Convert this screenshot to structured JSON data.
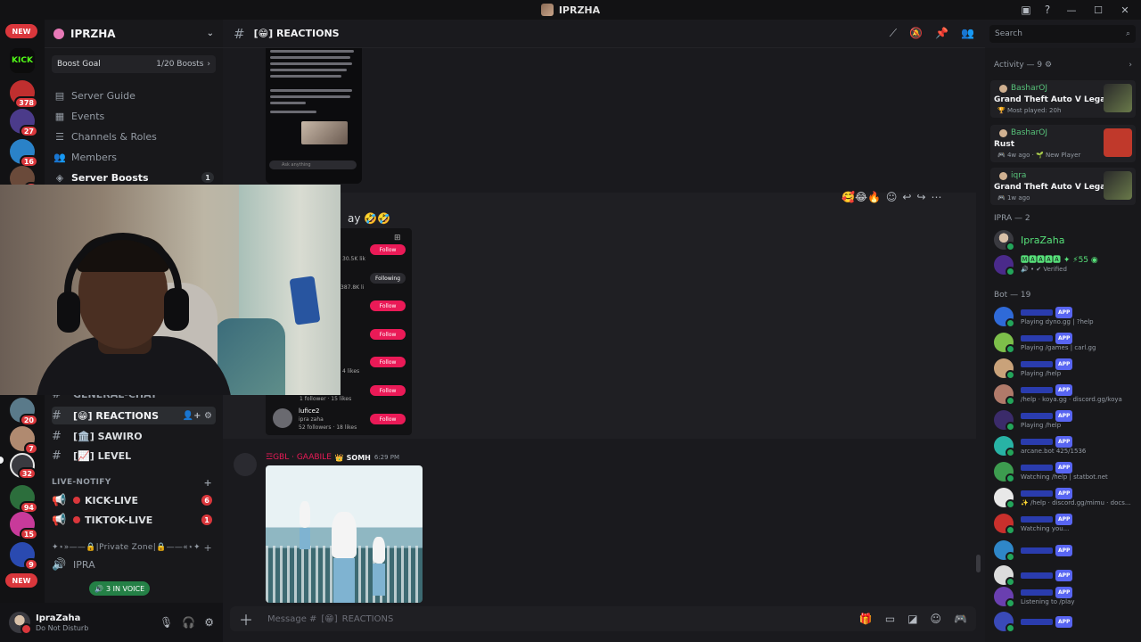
{
  "window": {
    "title": "IPRZHA"
  },
  "rail": {
    "new_label": "NEW",
    "kick_label": "KICK",
    "badges": [
      "378",
      "27",
      "16",
      "1",
      "20",
      "7",
      "32",
      "94",
      "15",
      "9"
    ]
  },
  "server": {
    "name": "IPRZHA",
    "boost_goal_label": "Boost Goal",
    "boost_progress": "1/20 Boosts",
    "nav": [
      {
        "label": "Server Guide"
      },
      {
        "label": "Events"
      },
      {
        "label": "Channels & Roles"
      },
      {
        "label": "Members"
      },
      {
        "label": "Server Boosts",
        "count": "1"
      }
    ]
  },
  "channels": {
    "partial": "GENERAL-CHAT",
    "list": [
      {
        "name": "REACTIONS",
        "prefix": "[😁]"
      },
      {
        "name": "SAWIRO",
        "prefix": "[🏛️]"
      },
      {
        "name": "LEVEL",
        "prefix": "[📈]"
      }
    ],
    "category_live": "LIVE-NOTIFY",
    "live": [
      {
        "name": "KICK-LIVE",
        "badge": "6"
      },
      {
        "name": "TIKTOK-LIVE",
        "badge": "1"
      }
    ],
    "private_zone": "✦⋆»——🔒|Private Zone|🔒——«⋆✦",
    "voice_channel": "IPRA",
    "voice_pill": "3 IN VOICE"
  },
  "user": {
    "name": "IpraZaha",
    "status": "Do Not Disturb"
  },
  "chat": {
    "channel_name": "REACTIONS",
    "channel_prefix": "[😁]",
    "search_placeholder": "Search",
    "input_placeholder": "Message #",
    "input_channel": "REACTIONS",
    "input_prefix": "[😁]",
    "emoji_suffix": "ay 🤣🤣",
    "reactions": "🥰😂🔥",
    "phone2": {
      "follow_label": "Follow",
      "following_label": "Following",
      "counts": [
        "30.5K lik",
        "387.8K li",
        "4 likes"
      ],
      "row_a": "1 follower · 15 likes",
      "user2_name": "lufice2",
      "user2_handle": "ipra zaha",
      "user2_stats": "52 followers · 18 likes"
    },
    "msg2": {
      "author": "☲GBL · GAABILE",
      "tag": "👑 SOMH",
      "time": "6:29 PM"
    }
  },
  "members": {
    "activity_header": "Activity — 9 ⚙",
    "activities": [
      {
        "user": "BasharOJ",
        "game": "Grand Theft Auto V Legacy",
        "sub": "🏆 Most played: 20h",
        "color": "#1c1c1c"
      },
      {
        "user": "BasharOJ",
        "game": "Rust",
        "sub": "🎮 4w ago · 🌱 New Player",
        "color": "#c0392b"
      },
      {
        "user": "iqra",
        "game": "Grand Theft Auto V Legacy",
        "sub": "🎮 1w ago",
        "color": "#1c1c1c"
      }
    ],
    "ipra_header": "IPRA — 2",
    "ipra": [
      {
        "name": "IpraZaha",
        "sub": ""
      },
      {
        "name": "🅼🅰🅰🅰🅰 ✦ ⚡55 ◉",
        "sub": "🔊 • ✔ Verified"
      }
    ],
    "bot_header": "Bot — 19",
    "bots": [
      {
        "status": "Playing dyno.gg | ?help",
        "color": "#2f6ad8"
      },
      {
        "status": "Playing /games | carl.gg",
        "color": "#7dbf4a"
      },
      {
        "status": "Playing /help",
        "color": "#c9a27a"
      },
      {
        "status": "/help · koya.gg · discord.gg/koya",
        "color": "#b07a6a"
      },
      {
        "status": "Playing /help",
        "color": "#3b2b6a"
      },
      {
        "status": "arcane.bot 425/1536",
        "color": "#28b3a5"
      },
      {
        "status": "Watching /help | statbot.net",
        "color": "#3d9c4f"
      },
      {
        "status": "✨ /help · discord.gg/mimu · docs...",
        "color": "#e8e8e8"
      },
      {
        "status": "Watching you...",
        "color": "#c9302c"
      },
      {
        "status": "",
        "color": "#2f87c8"
      },
      {
        "status": "",
        "color": "#dcdcdc"
      },
      {
        "status": "Listening to /play",
        "color": "#6a3fb0"
      },
      {
        "status": "",
        "color": "#3a4ab8"
      }
    ],
    "app_label": "APP"
  }
}
